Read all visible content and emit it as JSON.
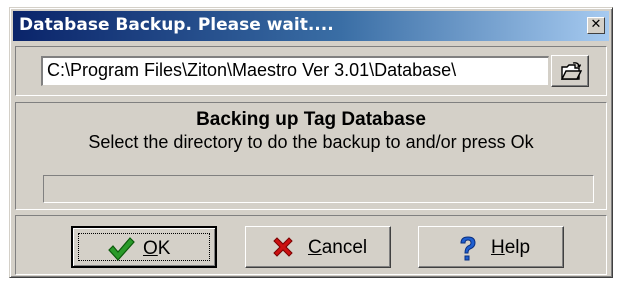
{
  "window": {
    "title": "Database Backup. Please wait....",
    "close_glyph": "✕"
  },
  "path": {
    "value": "C:\\Program Files\\Ziton\\Maestro Ver 3.01\\Database\\",
    "browse_icon": "open-folder-icon"
  },
  "status": {
    "title": "Backing up Tag Database",
    "subtitle": "Select the directory to do the backup to and/or press Ok",
    "progress": 0
  },
  "buttons": {
    "ok": {
      "accel": "O",
      "rest": "K",
      "icon": "checkmark-icon",
      "icon_color": "#2a9a2a"
    },
    "cancel": {
      "accel": "C",
      "rest": "ancel",
      "icon": "x-mark-icon",
      "icon_color": "#cc1111"
    },
    "help": {
      "accel": "H",
      "rest": "elp",
      "icon": "question-mark-icon",
      "icon_color": "#1f5fd0"
    }
  }
}
